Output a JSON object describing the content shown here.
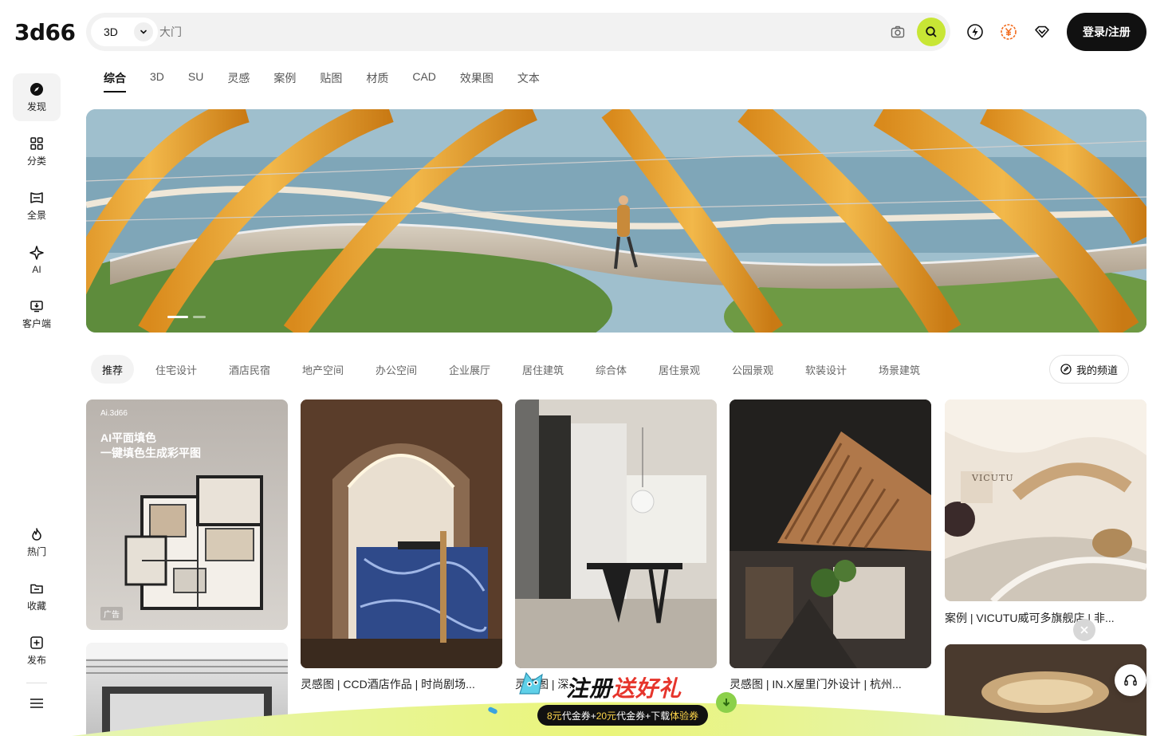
{
  "logo": "3d66",
  "search": {
    "scope": "3D",
    "placeholder": "大门"
  },
  "header": {
    "login_label": "登录/注册"
  },
  "top_tabs": [
    "综合",
    "3D",
    "SU",
    "灵感",
    "案例",
    "贴图",
    "材质",
    "CAD",
    "效果图",
    "文本"
  ],
  "rail": {
    "discover": "发现",
    "category": "分类",
    "panorama": "全景",
    "ai": "AI",
    "client": "客户端",
    "hot": "热门",
    "favorites": "收藏",
    "publish": "发布"
  },
  "chips": [
    "推荐",
    "住宅设计",
    "酒店民宿",
    "地产空间",
    "办公空间",
    "企业展厅",
    "居住建筑",
    "综合体",
    "居住景观",
    "公园景观",
    "软装设计",
    "场景建筑"
  ],
  "my_channel": "我的频道",
  "cards": {
    "ai_card": {
      "brand": "Ai.3d66",
      "line1": "AI平面填色",
      "line2": "一键填色生成彩平图",
      "ad": "广告"
    },
    "c2_caption": "灵感图 | CCD酒店作品 | 时尚剧场...",
    "c3_caption": "灵感图 | 深...",
    "c4_caption": "灵感图 | IN.X屋里门外设计 | 杭州...",
    "c5_caption": "案例 | VICUTU威可多旗舰店 | 非...",
    "c5_sign": "VICUTU"
  },
  "promo": {
    "title_a": "注册",
    "title_b": "送好礼",
    "sub_a": "8元",
    "sub_b": "代金券+",
    "sub_c": "20元",
    "sub_d": "代金券+下载",
    "sub_e": "体验券"
  },
  "colors": {
    "accent": "#c8e635",
    "promo_red": "#e6352c",
    "coin_orange": "#f26b1d"
  }
}
